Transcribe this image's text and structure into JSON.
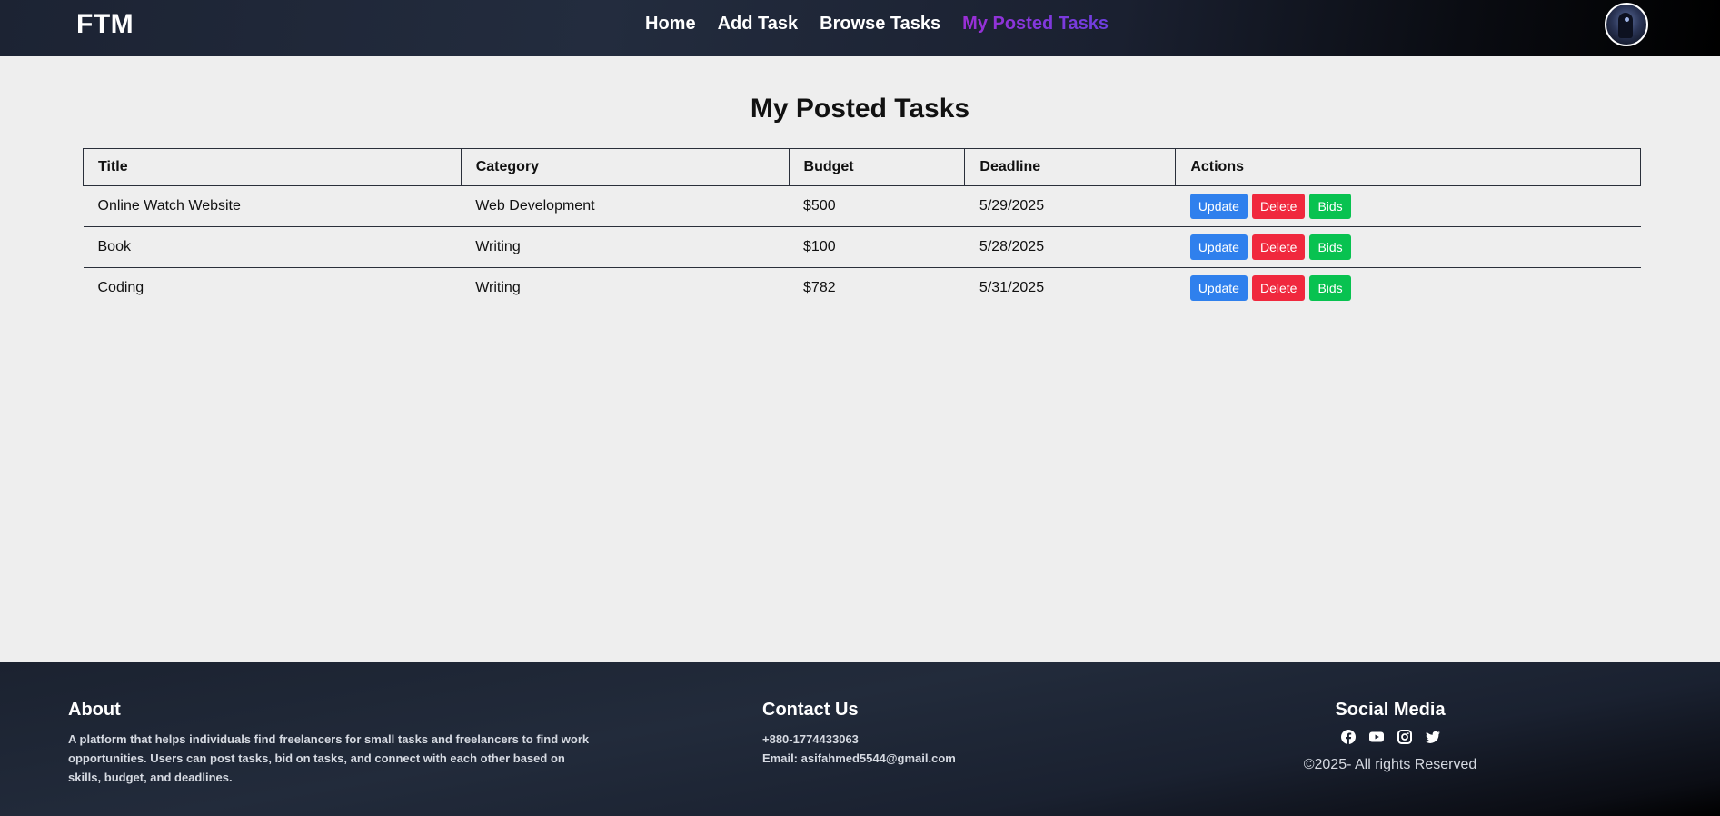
{
  "navbar": {
    "brand": "FTM",
    "links": [
      {
        "label": "Home"
      },
      {
        "label": "Add Task"
      },
      {
        "label": "Browse Tasks"
      },
      {
        "label": "My Posted Tasks"
      }
    ],
    "active_link": "My Posted Tasks",
    "active_color": "#9b2fd6"
  },
  "main": {
    "title": "My Posted Tasks",
    "table": {
      "headers": [
        "Title",
        "Category",
        "Budget",
        "Deadline",
        "Actions"
      ],
      "rows": [
        {
          "title": "Online Watch Website",
          "category": "Web Development",
          "budget": "$500",
          "deadline": "5/29/2025"
        },
        {
          "title": "Book",
          "category": "Writing",
          "budget": "$100",
          "deadline": "5/28/2025"
        },
        {
          "title": "Coding",
          "category": "Writing",
          "budget": "$782",
          "deadline": "5/31/2025"
        }
      ],
      "actions": {
        "update": "Update",
        "delete": "Delete",
        "bids": "Bids"
      }
    }
  },
  "footer": {
    "about": {
      "heading": "About",
      "text": "A platform that helps individuals find freelancers for small tasks and freelancers to find work opportunities. Users can post tasks, bid on tasks, and connect with each other based on skills, budget, and deadlines."
    },
    "contact": {
      "heading": "Contact Us",
      "phone": "+880-1774433063",
      "email": "Email: asifahmed5544@gmail.com"
    },
    "social": {
      "heading": "Social Media",
      "icons": [
        "facebook-icon",
        "youtube-icon",
        "instagram-icon",
        "twitter-icon"
      ],
      "copyright": "©2025- All rights Reserved"
    }
  },
  "colors": {
    "update": "#2f80ed",
    "delete": "#f0283d",
    "bids": "#08c250"
  }
}
